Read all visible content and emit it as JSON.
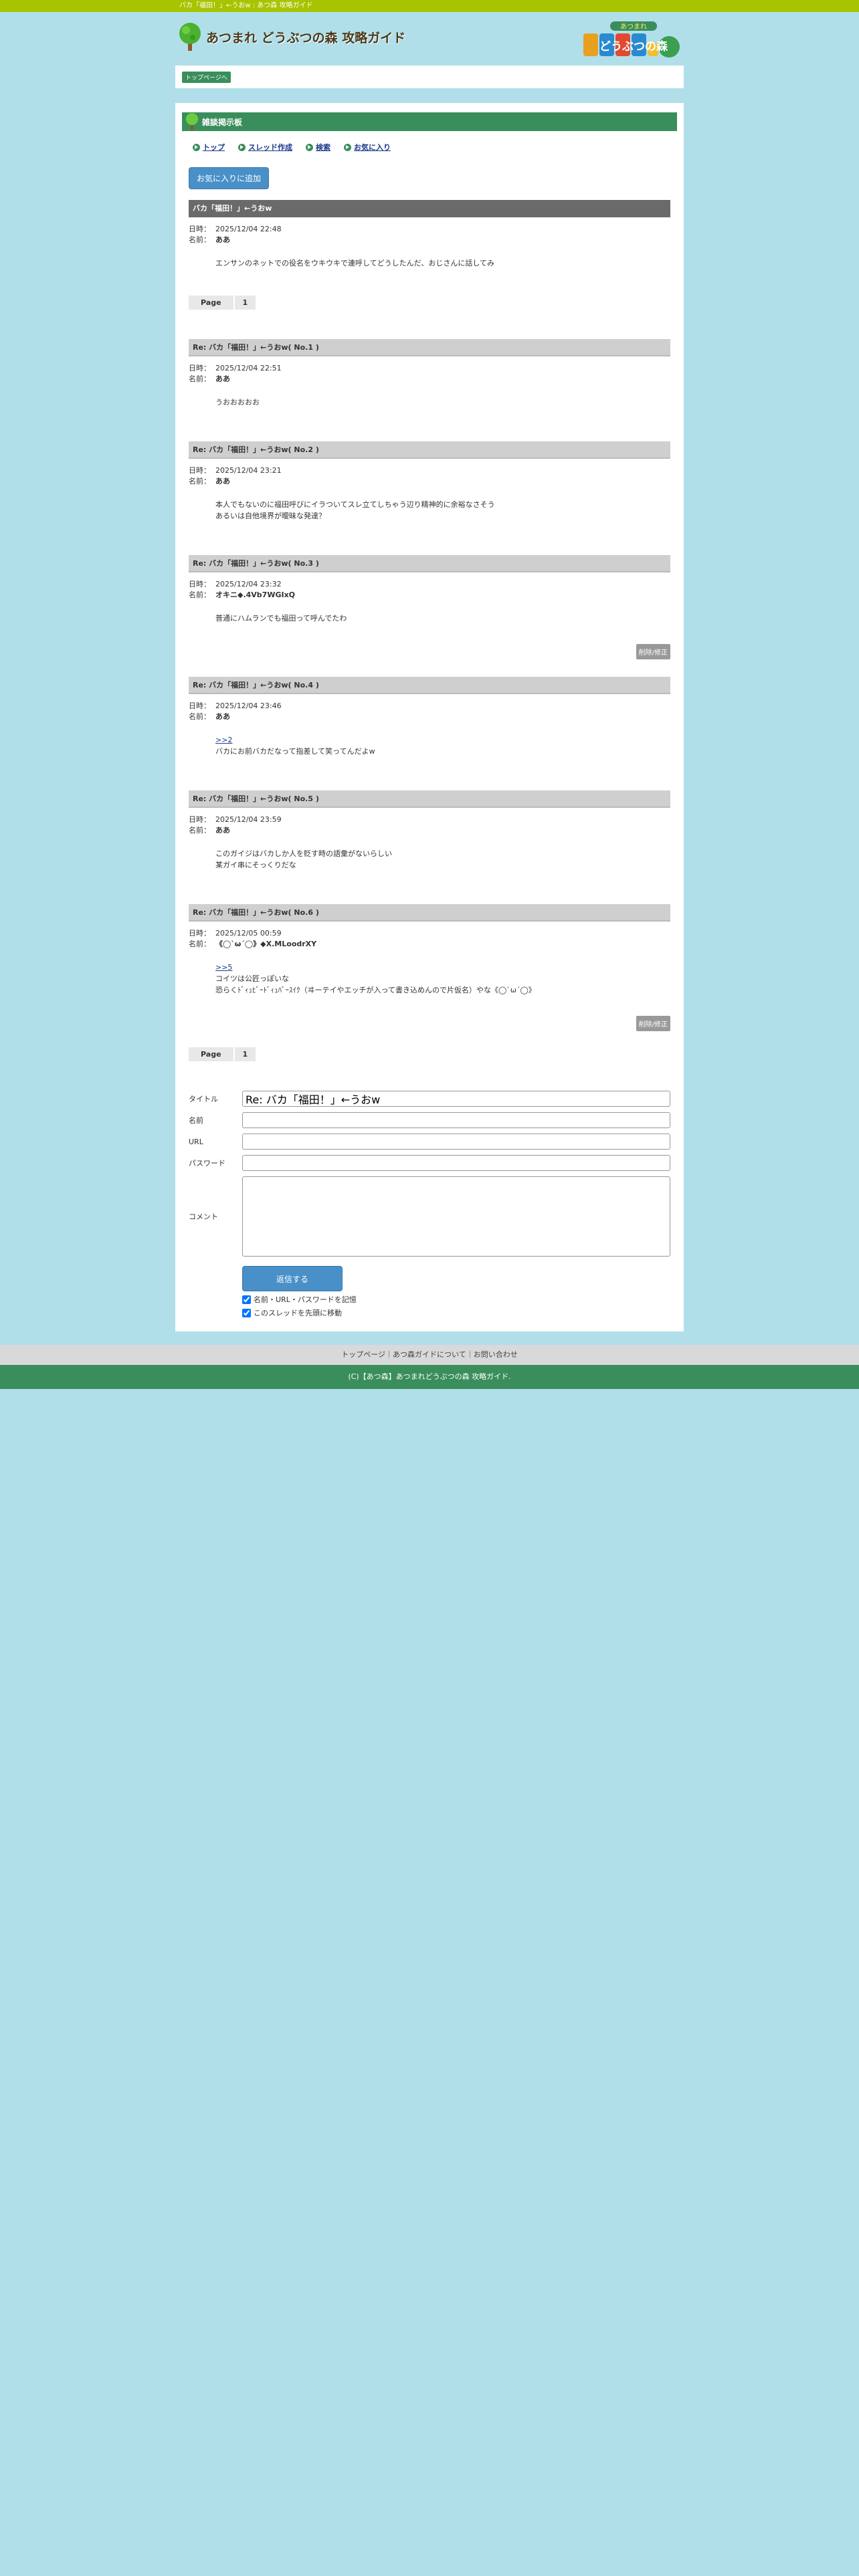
{
  "topbar": {
    "text": "バカ「福田！」←うおw : あつ森 攻略ガイド"
  },
  "header": {
    "site_title": "あつまれ どうぶつの森 攻略ガイド",
    "game_logo_top": "あつまれ",
    "game_logo_main": "どうぶつの森"
  },
  "breadcrumb": {
    "label": "トップページへ"
  },
  "board": {
    "title": "雑談掲示板",
    "menu": [
      {
        "label": "トップ",
        "icon": "arrow-circle-icon"
      },
      {
        "label": "スレッド作成",
        "icon": "arrow-circle-icon"
      },
      {
        "label": "検索",
        "icon": "arrow-circle-icon"
      },
      {
        "label": "お気に入り",
        "icon": "arrow-circle-icon"
      }
    ],
    "fav_button": "お気に入りに追加",
    "date_label": "日時：",
    "name_label": "名前：",
    "edit_button": "削除/修正"
  },
  "posts": [
    {
      "title": "バカ「福田！」←うおw",
      "date": "2025/12/04 22:48",
      "name": "ああ",
      "anchor": "",
      "lines": [
        "エンサンのネットでの役名をウキウキで連呼してどうしたんだ、おじさんに話してみ"
      ]
    },
    {
      "title": "Re: バカ「福田！」←うおw( No.1 )",
      "date": "2025/12/04 22:51",
      "name": "ああ",
      "anchor": "",
      "lines": [
        "うおおおおお"
      ]
    },
    {
      "title": "Re: バカ「福田！」←うおw( No.2 )",
      "date": "2025/12/04 23:21",
      "name": "ああ",
      "anchor": "",
      "lines": [
        "本人でもないのに福田呼びにイラついてスレ立てしちゃう辺り精神的に余裕なさそう",
        "あるいは自他境界が曖昧な発達？"
      ]
    },
    {
      "title": "Re: バカ「福田！」←うおw( No.3 )",
      "date": "2025/12/04 23:32",
      "name": "オキニ◆.4Vb7WGIxQ",
      "anchor": "",
      "lines": [
        "普通にハムランでも福田って呼んでたわ"
      ],
      "editable": true
    },
    {
      "title": "Re: バカ「福田！」←うおw( No.4 )",
      "date": "2025/12/04 23:46",
      "name": "ああ",
      "anchor": ">>2",
      "lines": [
        "バカにお前バカだなって指差して笑ってんだよw"
      ]
    },
    {
      "title": "Re: バカ「福田！」←うおw( No.5 )",
      "date": "2025/12/04 23:59",
      "name": "ああ",
      "anchor": "",
      "lines": [
        "このガイジはバカしか人を貶す時の語彙がないらしい",
        "某ガイ串にそっくりだな"
      ]
    },
    {
      "title": "Re: バカ「福田！」←うおw( No.6 )",
      "date": "2025/12/05 00:59",
      "name": "《◯`ω´◯》◆X.MLoodrXY",
      "anchor": ">>5",
      "lines": [
        "コイツは公匠っぽいな",
        "恐らくﾄﾞｨｭﾋﾞｰﾄﾞｨｭﾊﾞｰｽｲｸ（ヰーテイやエッチが入って書き込めんので片仮名）やな《◯`ω´◯》"
      ],
      "editable": true
    }
  ],
  "pager": {
    "label": "Page",
    "current": "1"
  },
  "form": {
    "title_label": "タイトル",
    "title_value": "Re: バカ「福田！」←うおw",
    "name_label": "名前",
    "url_label": "URL",
    "password_label": "パスワード",
    "comment_label": "コメント",
    "submit_label": "返信する",
    "remember_label": "名前・URL・パスワードを記憶",
    "move_label": "このスレッドを先頭に移動"
  },
  "footer": {
    "nav": "トップページ｜あつ森ガイドについて｜お問い合わせ",
    "copyright": "(C)【あつ森】あつまれどうぶつの森 攻略ガイド."
  },
  "colors": {
    "accent": "#3a8e5c",
    "topbar": "#a8c400",
    "background": "#b0dfea",
    "button": "#4a90c8"
  }
}
